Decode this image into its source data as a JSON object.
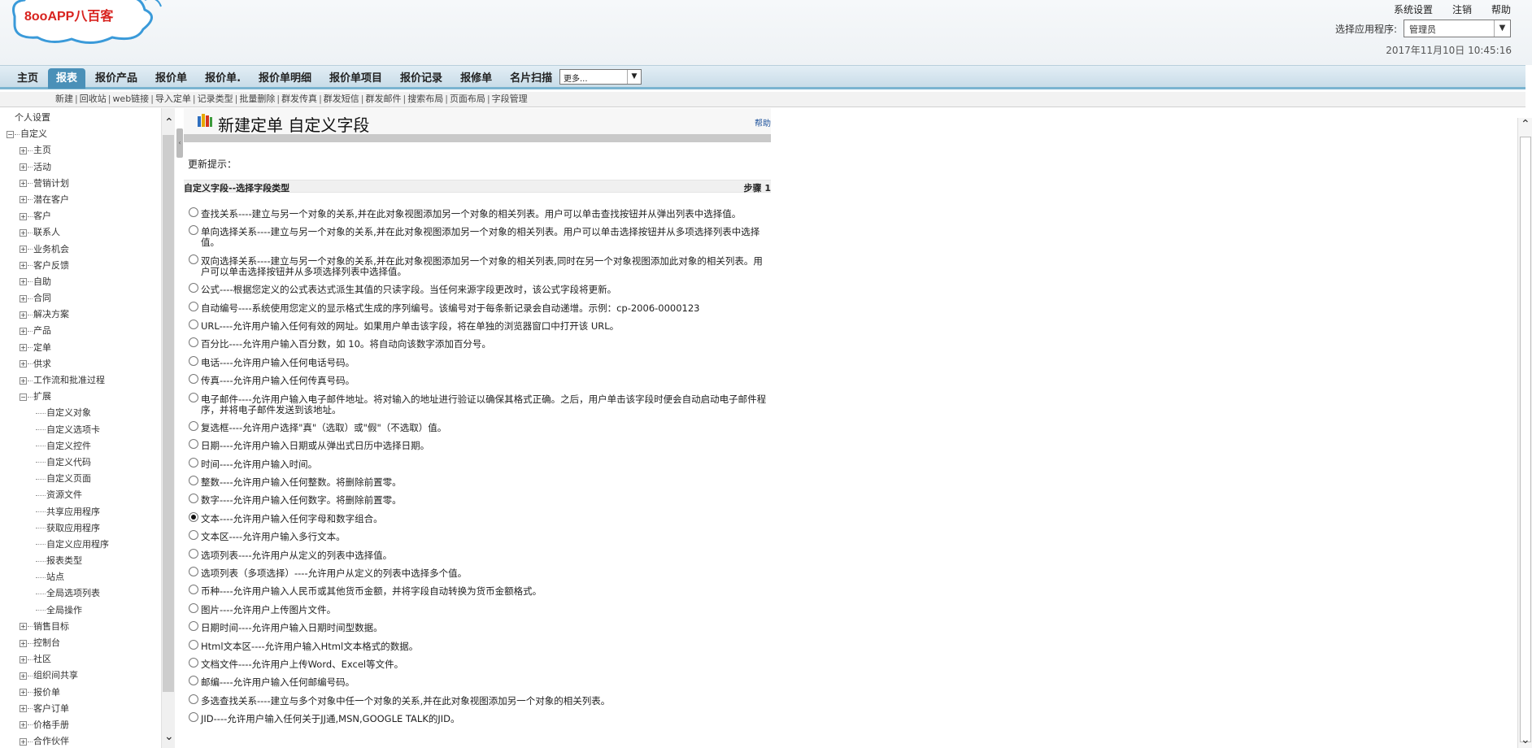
{
  "header": {
    "logo_text": "8ooAPP八百客",
    "links": [
      "系统设置",
      "注销",
      "帮助"
    ],
    "app_select_label": "选择应用程序:",
    "app_select_value": "管理员",
    "datetime": "2017年11月10日 10:45:16"
  },
  "nav": {
    "tabs": [
      "主页",
      "报表",
      "报价产品",
      "报价单",
      "报价单.",
      "报价单明细",
      "报价单项目",
      "报价记录",
      "报修单",
      "名片扫描"
    ],
    "active_tab": "报表",
    "more_select": "更多..."
  },
  "subnav": [
    "新建",
    "回收站",
    "web链接",
    "导入定单",
    "记录类型",
    "批量删除",
    "群发传真",
    "群发短信",
    "群发邮件",
    "搜索布局",
    "页面布局",
    "字段管理"
  ],
  "sidebar": {
    "items": [
      {
        "label": "个人设置",
        "level": 0,
        "kind": "root"
      },
      {
        "label": "自定义",
        "level": 0,
        "kind": "open"
      },
      {
        "label": "主页",
        "level": 1,
        "kind": "closed"
      },
      {
        "label": "活动",
        "level": 1,
        "kind": "closed"
      },
      {
        "label": "营销计划",
        "level": 1,
        "kind": "closed"
      },
      {
        "label": "潜在客户",
        "level": 1,
        "kind": "closed"
      },
      {
        "label": "客户",
        "level": 1,
        "kind": "closed"
      },
      {
        "label": "联系人",
        "level": 1,
        "kind": "closed"
      },
      {
        "label": "业务机会",
        "level": 1,
        "kind": "closed"
      },
      {
        "label": "客户反馈",
        "level": 1,
        "kind": "closed"
      },
      {
        "label": "自助",
        "level": 1,
        "kind": "closed"
      },
      {
        "label": "合同",
        "level": 1,
        "kind": "closed"
      },
      {
        "label": "解决方案",
        "level": 1,
        "kind": "closed"
      },
      {
        "label": "产品",
        "level": 1,
        "kind": "closed"
      },
      {
        "label": "定单",
        "level": 1,
        "kind": "closed"
      },
      {
        "label": "供求",
        "level": 1,
        "kind": "closed"
      },
      {
        "label": "工作流和批准过程",
        "level": 1,
        "kind": "closed"
      },
      {
        "label": "扩展",
        "level": 1,
        "kind": "open"
      },
      {
        "label": "自定义对象",
        "level": 2,
        "kind": "leaf"
      },
      {
        "label": "自定义选项卡",
        "level": 2,
        "kind": "leaf"
      },
      {
        "label": "自定义控件",
        "level": 2,
        "kind": "leaf"
      },
      {
        "label": "自定义代码",
        "level": 2,
        "kind": "leaf"
      },
      {
        "label": "自定义页面",
        "level": 2,
        "kind": "leaf"
      },
      {
        "label": "资源文件",
        "level": 2,
        "kind": "leaf"
      },
      {
        "label": "共享应用程序",
        "level": 2,
        "kind": "leaf"
      },
      {
        "label": "获取应用程序",
        "level": 2,
        "kind": "leaf"
      },
      {
        "label": "自定义应用程序",
        "level": 2,
        "kind": "leaf"
      },
      {
        "label": "报表类型",
        "level": 2,
        "kind": "leaf"
      },
      {
        "label": "站点",
        "level": 2,
        "kind": "leaf"
      },
      {
        "label": "全局选项列表",
        "level": 2,
        "kind": "leaf"
      },
      {
        "label": "全局操作",
        "level": 2,
        "kind": "leaf"
      },
      {
        "label": "销售目标",
        "level": 1,
        "kind": "closed"
      },
      {
        "label": "控制台",
        "level": 1,
        "kind": "closed"
      },
      {
        "label": "社区",
        "level": 1,
        "kind": "closed"
      },
      {
        "label": "组织间共享",
        "level": 1,
        "kind": "closed"
      },
      {
        "label": "报价单",
        "level": 1,
        "kind": "closed"
      },
      {
        "label": "客户订单",
        "level": 1,
        "kind": "closed"
      },
      {
        "label": "价格手册",
        "level": 1,
        "kind": "closed"
      },
      {
        "label": "合作伙伴",
        "level": 1,
        "kind": "closed"
      }
    ]
  },
  "main": {
    "title": "新建定单 自定义字段",
    "help": "帮助",
    "update_tip": "更新提示：",
    "section_title": "自定义字段--选择字段类型",
    "step": "步骤 1",
    "options": [
      "查找关系----建立与另一个对象的关系,并在此对象视图添加另一个对象的相关列表。用户可以单击查找按钮并从弹出列表中选择值。",
      "单向选择关系----建立与另一个对象的关系,并在此对象视图添加另一个对象的相关列表。用户可以单击选择按钮并从多项选择列表中选择值。",
      "双向选择关系----建立与另一个对象的关系,并在此对象视图添加另一个对象的相关列表,同时在另一个对象视图添加此对象的相关列表。用户可以单击选择按钮并从多项选择列表中选择值。",
      "公式----根据您定义的公式表达式派生其值的只读字段。当任何来源字段更改时，该公式字段将更新。",
      "自动编号----系统使用您定义的显示格式生成的序列编号。该编号对于每条新记录会自动递增。示例：cp-2006-0000123",
      "URL----允许用户输入任何有效的网址。如果用户单击该字段，将在单独的浏览器窗口中打开该 URL。",
      "百分比----允许用户输入百分数，如 10。将自动向该数字添加百分号。",
      "电话----允许用户输入任何电话号码。",
      "传真----允许用户输入任何传真号码。",
      "电子邮件----允许用户输入电子邮件地址。将对输入的地址进行验证以确保其格式正确。之后，用户单击该字段时便会自动启动电子邮件程序，并将电子邮件发送到该地址。",
      "复选框----允许用户选择\"真\"（选取）或\"假\"（不选取）值。",
      "日期----允许用户输入日期或从弹出式日历中选择日期。",
      "时间----允许用户输入时间。",
      "整数----允许用户输入任何整数。将删除前置零。",
      "数字----允许用户输入任何数字。将删除前置零。",
      "文本----允许用户输入任何字母和数字组合。",
      "文本区----允许用户输入多行文本。",
      "选项列表----允许用户从定义的列表中选择值。",
      "选项列表（多项选择）----允许用户从定义的列表中选择多个值。",
      "币种----允许用户输入人民币或其他货币金额，并将字段自动转换为货币金额格式。",
      "图片----允许用户上传图片文件。",
      "日期时间----允许用户输入日期时间型数据。",
      "Html文本区----允许用户输入Html文本格式的数据。",
      "文档文件----允许用户上传Word、Excel等文件。",
      "邮编----允许用户输入任何邮编号码。",
      "多选查找关系----建立与多个对象中任一个对象的关系,并在此对象视图添加另一个对象的相关列表。",
      "JID----允许用户输入任何关于JJ通,MSN,GOOGLE TALK的JID。"
    ],
    "selected_index": 15
  }
}
